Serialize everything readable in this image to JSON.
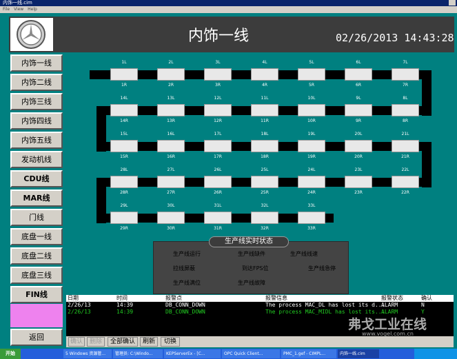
{
  "window": {
    "title": "内饰一线.cim"
  },
  "menu": [
    "File",
    "View",
    "Help"
  ],
  "header": {
    "title": "内饰一线",
    "datetime": "02/26/2013  14:43:28"
  },
  "sidebar": {
    "items": [
      "内饰一线",
      "内饰二线",
      "内饰三线",
      "内饰四线",
      "内饰五线",
      "发动机线",
      "CDU线",
      "MAR线",
      "门线",
      "底盘一线",
      "底盘二线",
      "底盘三线",
      "FIN线"
    ],
    "back": "返回"
  },
  "stations": [
    {
      "top": "1L",
      "bottom": "1R"
    },
    {
      "top": "2L",
      "bottom": "2R"
    },
    {
      "top": "3L",
      "bottom": "3R"
    },
    {
      "top": "4L",
      "bottom": "4R"
    },
    {
      "top": "5L",
      "bottom": "5R"
    },
    {
      "top": "6L",
      "bottom": "6R"
    },
    {
      "top": "7L",
      "bottom": "7R"
    },
    {
      "top": "14L",
      "bottom": "14R"
    },
    {
      "top": "13L",
      "bottom": "13R"
    },
    {
      "top": "12L",
      "bottom": "12R"
    },
    {
      "top": "11L",
      "bottom": "11R"
    },
    {
      "top": "10L",
      "bottom": "10R"
    },
    {
      "top": "9L",
      "bottom": "9R"
    },
    {
      "top": "8L",
      "bottom": "8R"
    },
    {
      "top": "15L",
      "bottom": "15R"
    },
    {
      "top": "16L",
      "bottom": "16R"
    },
    {
      "top": "17L",
      "bottom": "17R"
    },
    {
      "top": "18L",
      "bottom": "18R"
    },
    {
      "top": "19L",
      "bottom": "19R"
    },
    {
      "top": "20L",
      "bottom": "20R"
    },
    {
      "top": "21L",
      "bottom": "21R"
    },
    {
      "top": "28L",
      "bottom": "28R"
    },
    {
      "top": "27L",
      "bottom": "27R"
    },
    {
      "top": "26L",
      "bottom": "26R"
    },
    {
      "top": "25L",
      "bottom": "25R"
    },
    {
      "top": "24L",
      "bottom": "24R"
    },
    {
      "top": "23L",
      "bottom": "23R"
    },
    {
      "top": "22L",
      "bottom": "22R"
    },
    {
      "top": "29L",
      "bottom": "29R"
    },
    {
      "top": "30L",
      "bottom": "30R"
    },
    {
      "top": "31L",
      "bottom": "31R"
    },
    {
      "top": "32L",
      "bottom": "32R"
    },
    {
      "top": "33L",
      "bottom": "33R"
    }
  ],
  "status_panel": {
    "title": "生产线实时状态",
    "items": [
      "生产线运行",
      "生产线缺件",
      "生产线线速",
      "拉线屏蔽",
      "到达FPS位",
      "生产线急停",
      "生产线满位",
      "生产线故障"
    ]
  },
  "alarms": {
    "columns": [
      "日期",
      "时间",
      "报警点",
      "报警信息",
      "报警状态",
      "确认"
    ],
    "rows": [
      {
        "date": "2/26/13",
        "time": "14:39",
        "point": "DB_CONN_DOWN",
        "message": "The process MAC_DL has lost its d...",
        "status": "ALARM",
        "ack": "N",
        "color": "#ffffff"
      },
      {
        "date": "2/26/13",
        "time": "14:39",
        "point": "DB_CONN_DOWN",
        "message": "The process MAC_MIDL has lost its...",
        "status": "ALARM",
        "ack": "Y",
        "color": "#22cc22"
      }
    ]
  },
  "toolbar": [
    "确认",
    "删除",
    "全部确认",
    "刷新",
    "切换"
  ],
  "taskbar": {
    "start": "开始",
    "tasks": [
      "5 Windows 资源管...",
      "管理员: C:\\Windo...",
      "KEPServerEx - [C...",
      "OPC Quick Client...",
      "PMC_1.gef - CIMPL...",
      "内饰一线.cim"
    ]
  },
  "watermark": {
    "brand": "弗戈工业在线",
    "url": "www.vogel.com.cn"
  }
}
